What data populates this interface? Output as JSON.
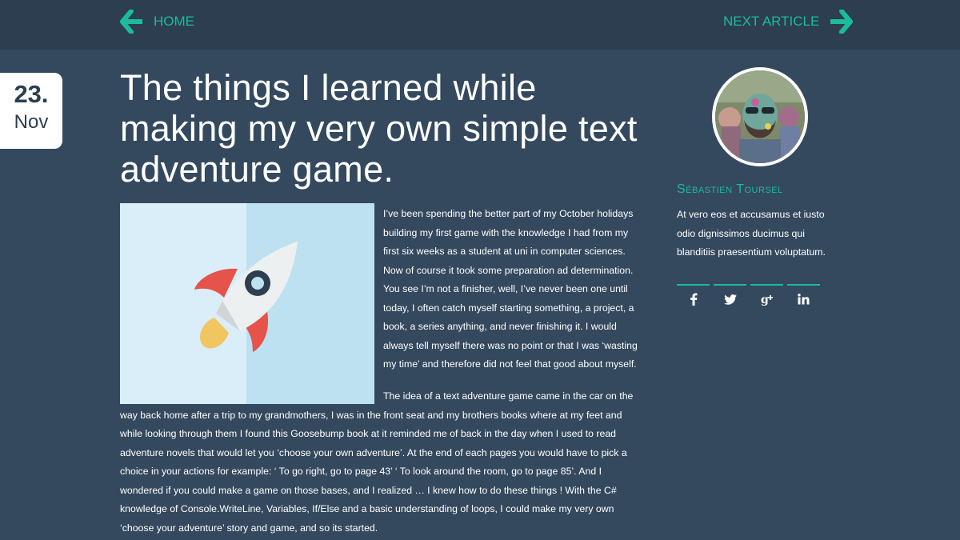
{
  "nav": {
    "home_label": "HOME",
    "next_label": "NEXT ARTICLE",
    "arrow_color": "#1abc9c"
  },
  "date": {
    "day": "23.",
    "month": "Nov"
  },
  "article": {
    "title": "The things I learned while making my very own simple text adventure game.",
    "hero_icon": "rocket-icon",
    "paragraphs": [
      "I’ve been spending the better part of my October holidays building my first game with the knowledge I had from my first six weeks as a student at uni in computer sciences. Now of course it took some preparation ad determination. You see I’m not a finisher, well, I’ve never been one until today, I often catch myself starting something, a project, a book, a series anything, and never finishing it. I would always tell myself there was no point or that I was ‘wasting my time’ and therefore did not feel that good about myself.",
      "The idea of a text adventure game came in the car on the way back home after a trip to my grandmothers, I was in the front seat and my brothers books where at my feet and while looking through them I found this Goosebump book at it reminded me of back in the day when I used to read adventure novels that would let you ‘choose your own adventure’. At the end of each pages you would have to pick a choice in your actions for example: ‘ To go right, go to page 43’ ‘ To look around the room, go to page 85’. And I wondered if you could make a game on those bases, and I realized … I knew how to do these things ! With the C# knowledge of Console.WriteLine, Variables, If/Else and a basic understanding of loops, I could make my very own ‘choose your adventure’ story and game, and so its started."
    ]
  },
  "author": {
    "name": "Sébastien Toursel",
    "bio": "At vero eos et accusamus et iusto odio dignissimos ducimus qui blanditiis praesentium voluptatum."
  },
  "social": [
    {
      "icon": "facebook-icon"
    },
    {
      "icon": "twitter-icon"
    },
    {
      "icon": "google-plus-icon"
    },
    {
      "icon": "linkedin-icon"
    }
  ],
  "colors": {
    "background": "#34495e",
    "topbar": "#2c3e50",
    "accent": "#1abc9c"
  }
}
